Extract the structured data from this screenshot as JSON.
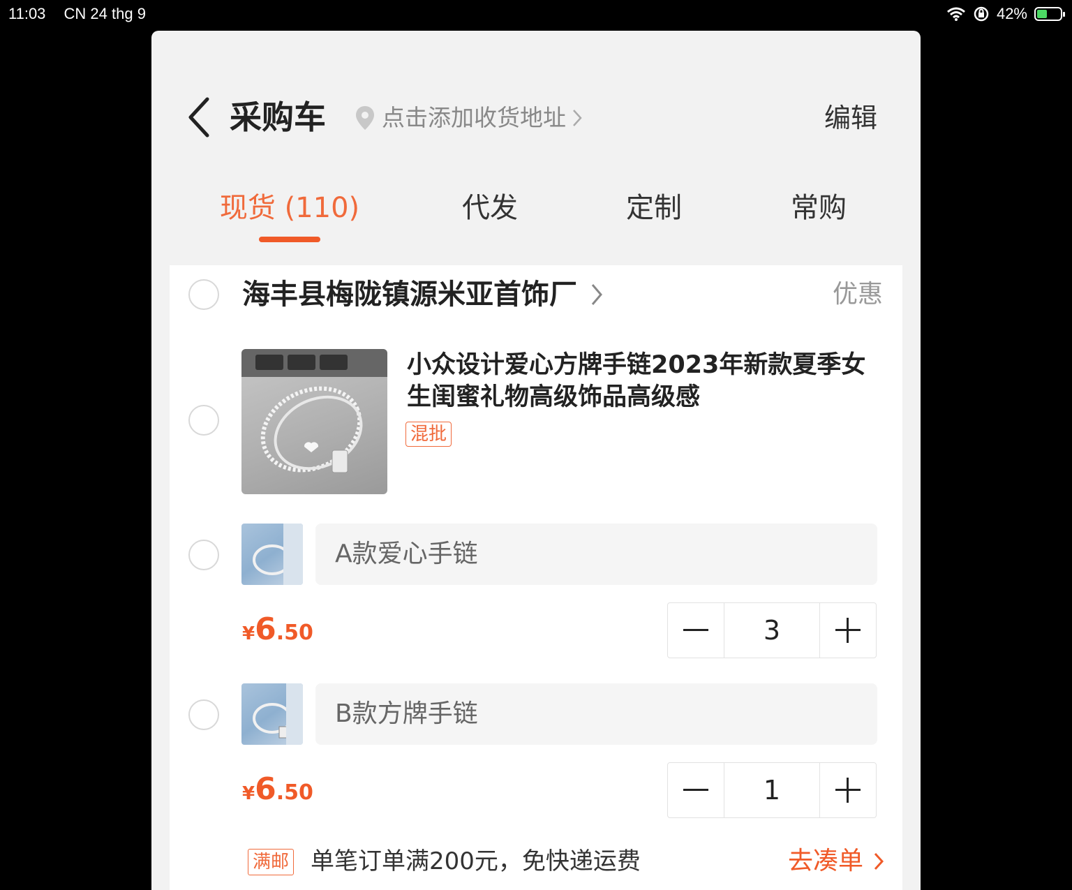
{
  "status_bar": {
    "time": "11:03",
    "date": "CN 24 thg 9",
    "battery": "42%"
  },
  "header": {
    "title": "采购车",
    "address_placeholder": "点击添加收货地址",
    "edit_label": "编辑"
  },
  "tabs": [
    {
      "label": "现货 (110)",
      "active": true
    },
    {
      "label": "代发",
      "active": false
    },
    {
      "label": "定制",
      "active": false
    },
    {
      "label": "常购",
      "active": false
    }
  ],
  "shop": {
    "name": "海丰县梅陇镇源米亚首饰厂",
    "discount_label": "优惠"
  },
  "product": {
    "title": "小众设计爱心方牌手链2023年新款夏季女生闺蜜礼物高级饰品高级感",
    "tag": "混批",
    "skus": [
      {
        "label": "A款爱心手链",
        "currency": "¥",
        "price_int": "6",
        "price_dec": ".50",
        "quantity": "3"
      },
      {
        "label": "B款方牌手链",
        "currency": "¥",
        "price_int": "6",
        "price_dec": ".50",
        "quantity": "1"
      }
    ]
  },
  "promo": {
    "tag": "满邮",
    "text": "单笔订单满200元，免快递运费",
    "link": "去凑单"
  },
  "colors": {
    "accent": "#f05a28",
    "tab_active": "#f06a3b",
    "sheet_bg": "#f2f2f2"
  }
}
